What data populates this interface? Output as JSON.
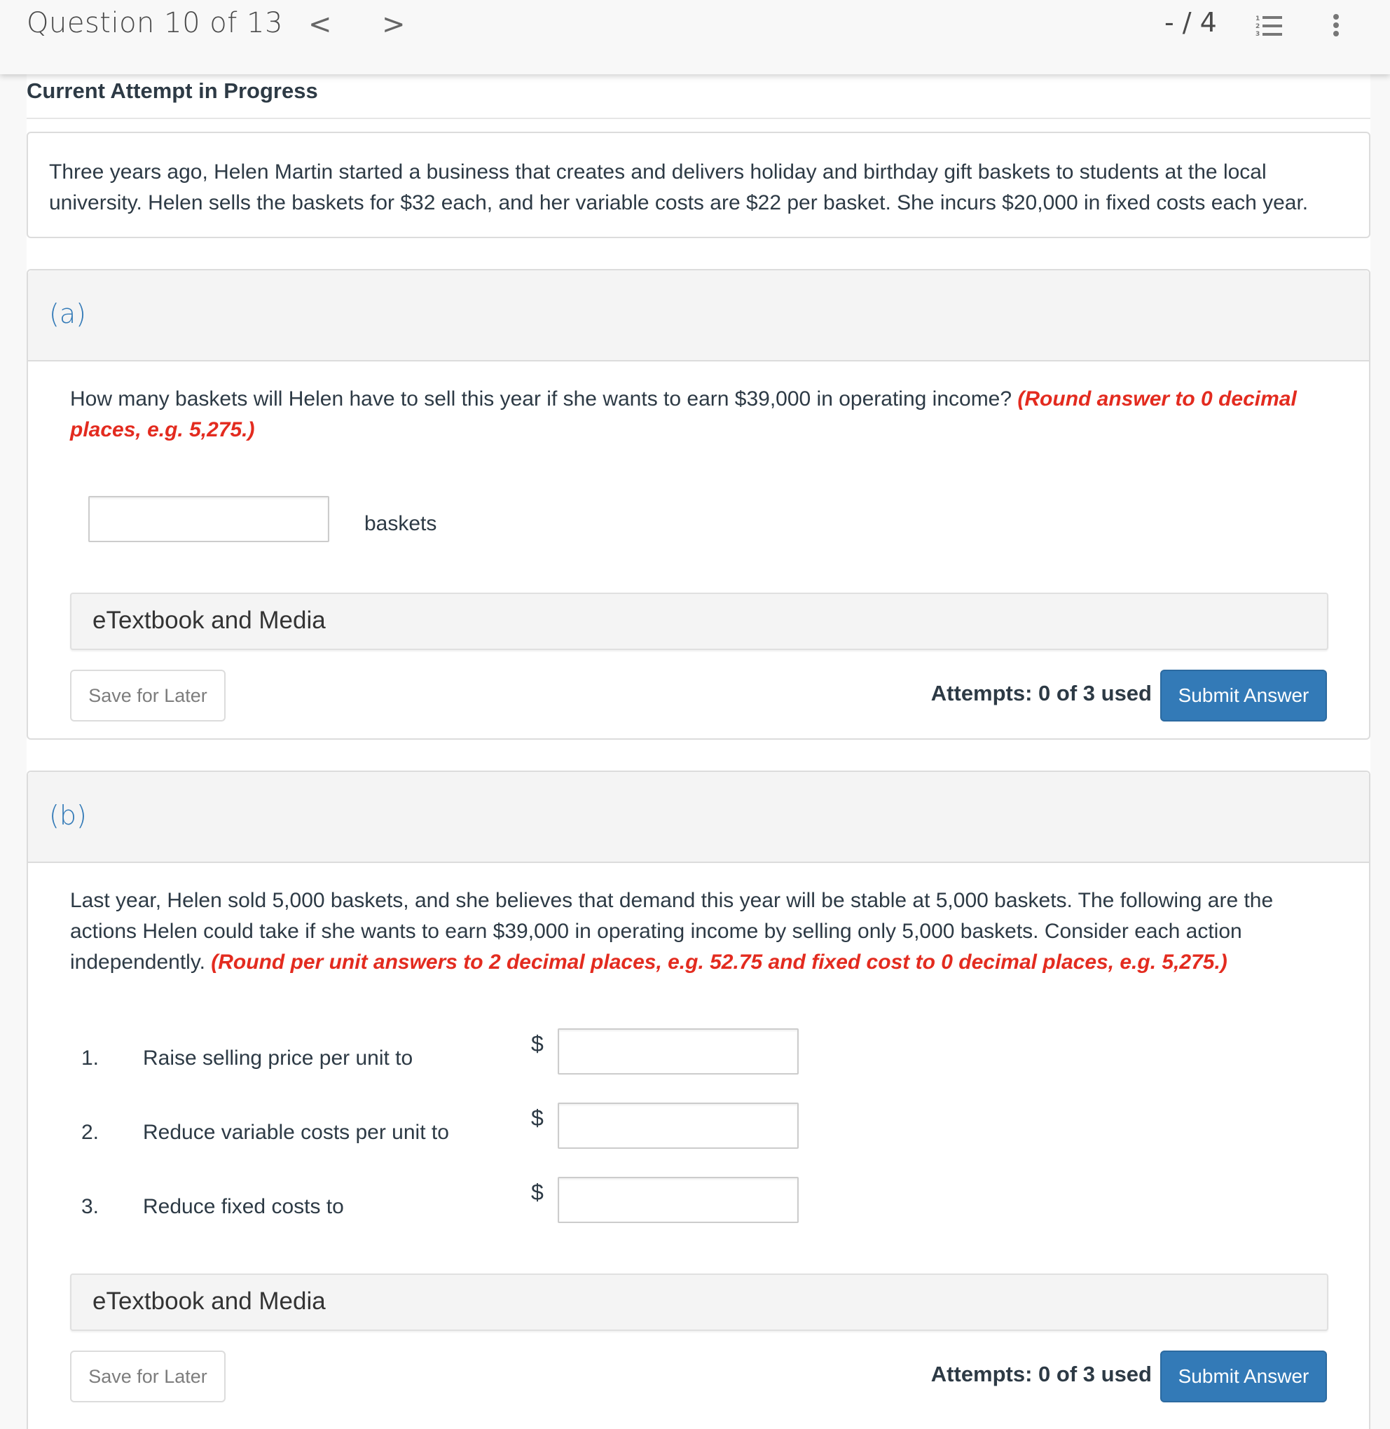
{
  "header": {
    "question_label": "Question 10 of 13",
    "prev_icon": "chevron-left-icon",
    "next_icon": "chevron-right-icon",
    "prev_glyph": "<",
    "next_glyph": ">",
    "score": "- / 4",
    "list_icon": "numbered-list-icon",
    "more_icon": "more-vertical-icon"
  },
  "attempt_heading": "Current Attempt in Progress",
  "stem": "Three years ago, Helen Martin started a business that creates and delivers holiday and birthday gift baskets to students at the local university. Helen sells the baskets for $32 each, and her variable costs are $22 per basket. She incurs $20,000 in fixed costs each year.",
  "colors": {
    "accent": "#337ab7",
    "hint": "#e32b1f",
    "text": "#2d3a45"
  },
  "part_a": {
    "letter": "(a)",
    "question": "How many baskets will Helen have to sell this year if she wants to earn $39,000 in operating income? ",
    "hint": "(Round answer to 0 decimal places, e.g. 5,275.)",
    "input_value": "",
    "unit": "baskets",
    "etextbook": "eTextbook and Media",
    "save_label": "Save for Later",
    "attempts": "Attempts: 0 of 3 used",
    "submit_label": "Submit Answer"
  },
  "part_b": {
    "letter": "(b)",
    "question": "Last year, Helen sold 5,000 baskets, and she believes that demand this year will be stable at 5,000 baskets. The following are the actions Helen could take if she wants to earn $39,000 in operating income by selling only 5,000 baskets. Consider each action independently. ",
    "hint": "(Round per unit answers to 2 decimal places, e.g. 52.75 and fixed cost to 0 decimal places, e.g. 5,275.)",
    "actions": [
      {
        "num": "1.",
        "label": "Raise selling price per unit to",
        "currency": "$",
        "value": ""
      },
      {
        "num": "2.",
        "label": "Reduce variable costs per unit to",
        "currency": "$",
        "value": ""
      },
      {
        "num": "3.",
        "label": "Reduce fixed costs to",
        "currency": "$",
        "value": ""
      }
    ],
    "etextbook": "eTextbook and Media",
    "save_label": "Save for Later",
    "attempts": "Attempts: 0 of 3 used",
    "submit_label": "Submit Answer"
  }
}
